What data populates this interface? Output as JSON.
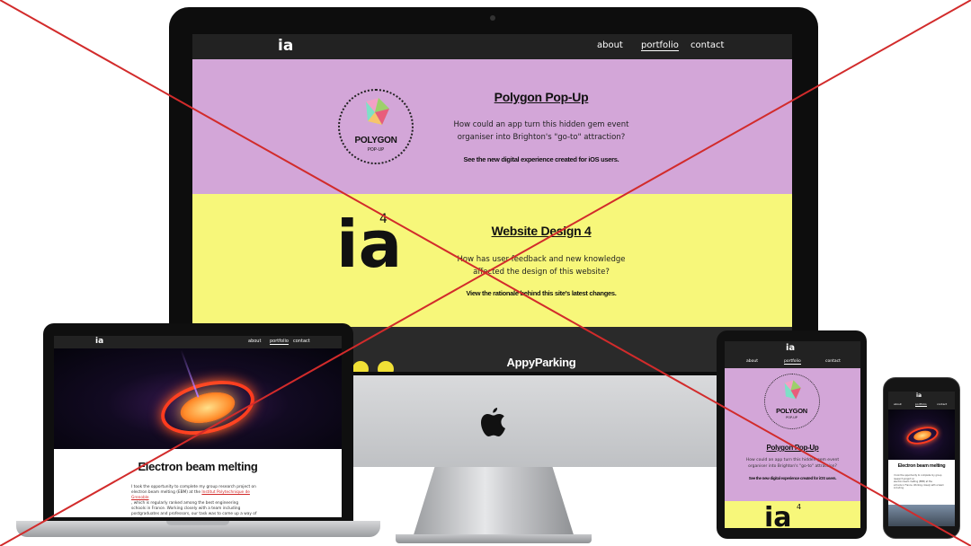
{
  "site": {
    "brand": "ia",
    "nav": {
      "about": "about",
      "portfolio": "portfolio",
      "contact": "contact"
    }
  },
  "projects": {
    "polygon": {
      "title": "Polygon Pop-Up",
      "desc_line1": "How could an app turn this hidden gem event",
      "desc_line2": "organiser into Brighton's \"go-to\" attraction?",
      "cta": "See the new digital experience created for iOS users.",
      "logo_line1": "POLYGON",
      "logo_line2": "POP-UP"
    },
    "website": {
      "title": "Website Design 4",
      "desc_line1": "How has user feedback and new knowledge",
      "desc_line2": "affected the design of this website?",
      "cta": "View the rationale behind this site's latest changes.",
      "logo_text": "ia",
      "logo_superscript": "4"
    },
    "appy": {
      "title": "AppyParking"
    }
  },
  "laptop_page": {
    "title": "Electron beam melting",
    "body_1": "I took the opportunity to complete my group research project on",
    "body_2": "electron beam melting (EBM) at the",
    "body_link": "Institut Polytechnique de Grenoble",
    "body_3": ", which is regularly ranked among the best engineering",
    "body_4": "schools in France. Working closely with a team including",
    "body_5": "postgraduates and professors, our task was to come up a way of"
  },
  "colors": {
    "purple": "#d3a6d8",
    "yellow": "#f7f77a",
    "nav_dark": "#222222",
    "cross_red": "#d22b2b"
  }
}
